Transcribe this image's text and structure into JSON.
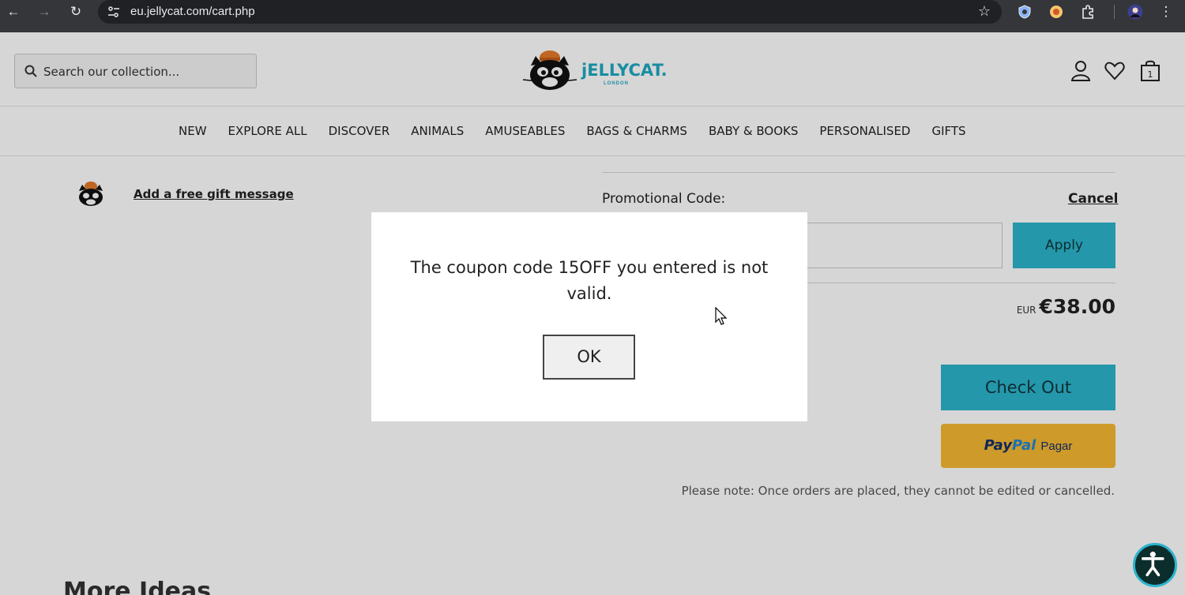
{
  "browser": {
    "url": "eu.jellycat.com/cart.php",
    "back": "←",
    "forward": "→",
    "reload": "↻",
    "star": "☆",
    "menu": "⋮"
  },
  "header": {
    "search_placeholder": "Search our collection...",
    "logo_text": "jELLYCAT.",
    "logo_sub": "LONDON"
  },
  "nav": {
    "items": [
      "NEW",
      "EXPLORE ALL",
      "DISCOVER",
      "ANIMALS",
      "AMUSEABLES",
      "BAGS & CHARMS",
      "BABY & BOOKS",
      "PERSONALISED",
      "GIFTS"
    ]
  },
  "cart": {
    "gift_message_link": "Add a free gift message",
    "promo_label": "Promotional Code:",
    "cancel_label": "Cancel",
    "apply_label": "Apply",
    "currency": "EUR",
    "total": "€38.00",
    "checkout_label": "Check Out",
    "paypal_pay": "Pay",
    "paypal_pal": "Pal",
    "paypal_label": "Pagar",
    "note": "Please note: Once orders are placed, they cannot be edited or cancelled.",
    "more_ideas": "More Ideas"
  },
  "modal": {
    "message": "The coupon code 15OFF you entered is not valid.",
    "ok_label": "OK"
  },
  "colors": {
    "accent": "#2bb4cc",
    "paypal": "#f6b832",
    "browser_chrome": "#35363a"
  }
}
